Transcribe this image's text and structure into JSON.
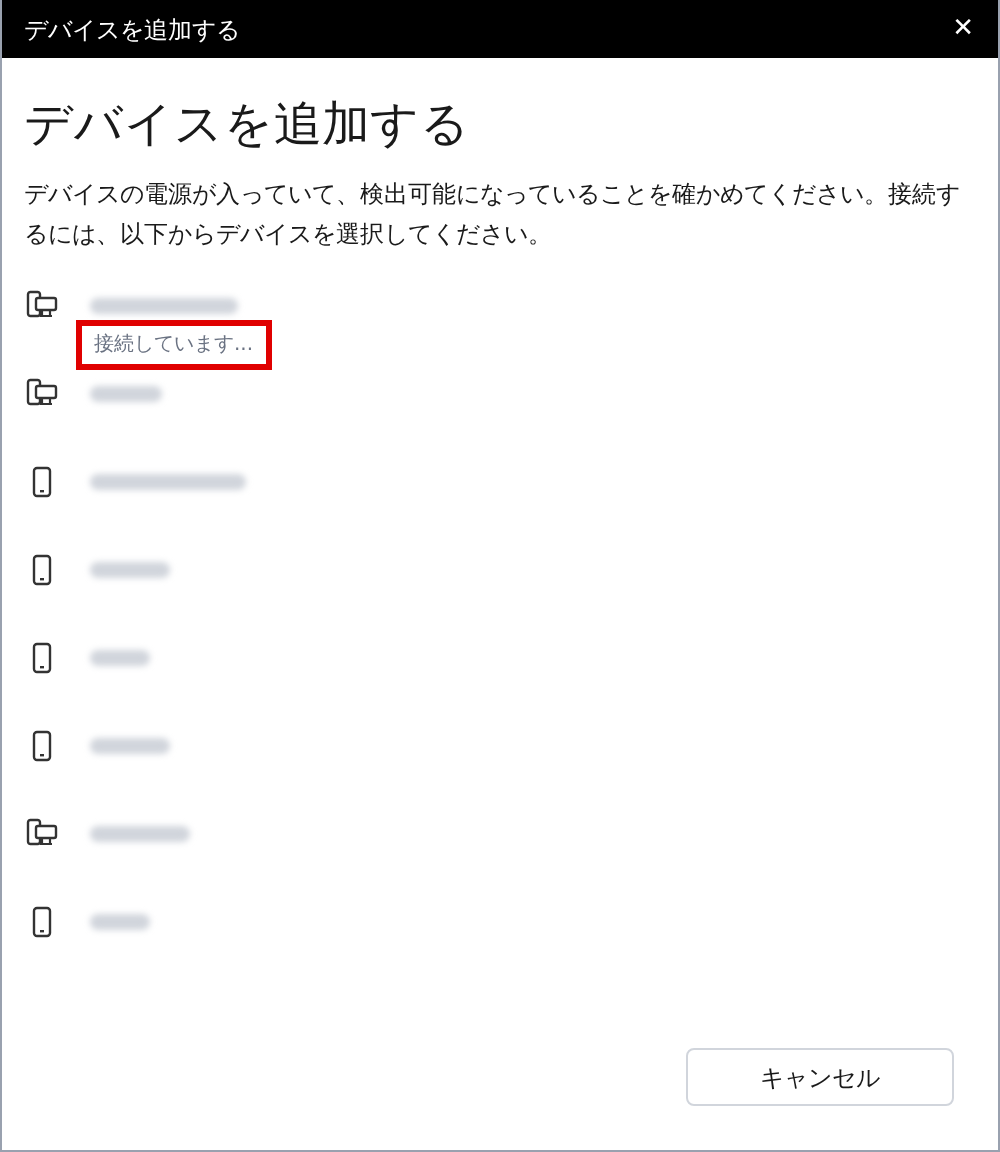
{
  "window": {
    "title": "デバイスを追加する",
    "close": "✕"
  },
  "heading": "デバイスを追加する",
  "description": "デバイスの電源が入っていて、検出可能になっていることを確かめてください。接続するには、以下からデバイスを選択してください。",
  "devices": [
    {
      "kind": "phone-pc",
      "status": "接続しています..."
    },
    {
      "kind": "phone-pc"
    },
    {
      "kind": "phone"
    },
    {
      "kind": "phone"
    },
    {
      "kind": "phone"
    },
    {
      "kind": "phone"
    },
    {
      "kind": "phone-pc"
    },
    {
      "kind": "phone"
    }
  ],
  "buttons": [
    "キャンセル"
  ]
}
